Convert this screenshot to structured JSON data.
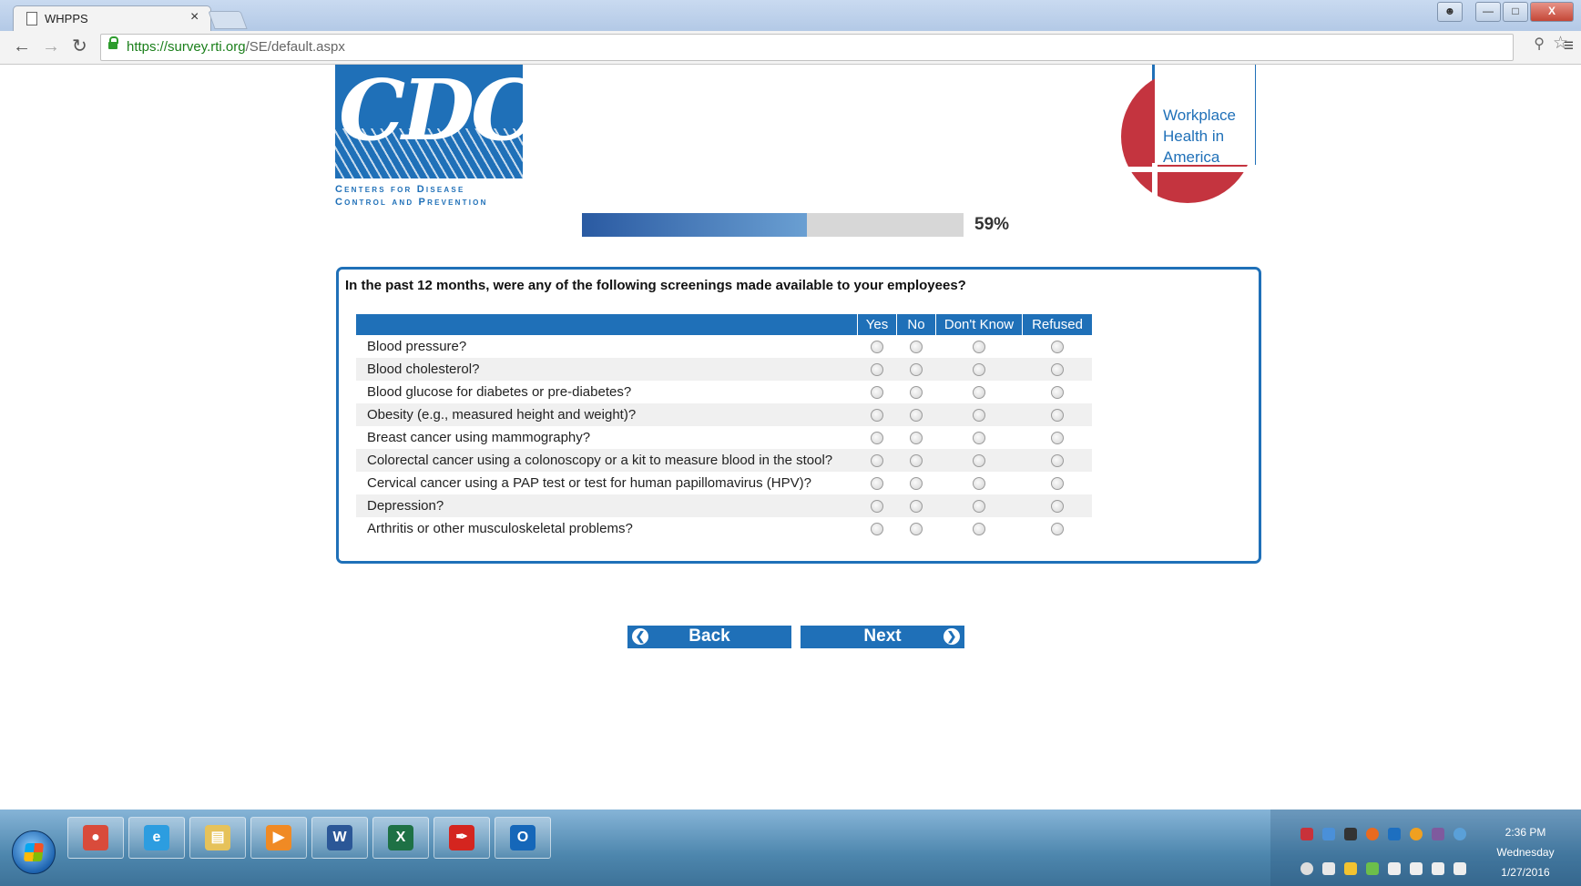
{
  "browser": {
    "tab_title": "WHPPS",
    "url_host": "https://survey.rti.org",
    "url_path": "/SE/default.aspx"
  },
  "logos": {
    "cdc_letters": "CDC",
    "cdc_line1": "Centers for Disease",
    "cdc_line2": "Control and Prevention",
    "whia_line1": "Workplace",
    "whia_line2": "Health in",
    "whia_line3": "America"
  },
  "progress": {
    "percent_label": "59%",
    "value": 0.59
  },
  "question": {
    "text": "In the past 12 months, were any of the following screenings made available to your employees?",
    "columns": [
      "Yes",
      "No",
      "Don't Know",
      "Refused"
    ],
    "rows": [
      "Blood pressure?",
      "Blood cholesterol?",
      "Blood glucose for diabetes or pre-diabetes?",
      "Obesity (e.g., measured height and weight)?",
      "Breast cancer using mammography?",
      "Colorectal cancer using a colonoscopy or a kit to measure blood in the stool?",
      "Cervical cancer using a PAP test or test for human papillomavirus (HPV)?",
      "Depression?",
      "Arthritis or other musculoskeletal problems?"
    ]
  },
  "nav": {
    "back_label": "Back",
    "next_label": "Next"
  },
  "taskbar": {
    "apps": [
      "chrome-icon",
      "internet-explorer-icon",
      "file-explorer-icon",
      "media-player-icon",
      "word-icon",
      "excel-icon",
      "acrobat-icon",
      "outlook-icon"
    ],
    "time": "2:36 PM",
    "day": "Wednesday",
    "date": "1/27/2016"
  },
  "colors": {
    "brand_blue": "#1f70b8",
    "cdc_red": "#c4343f"
  }
}
